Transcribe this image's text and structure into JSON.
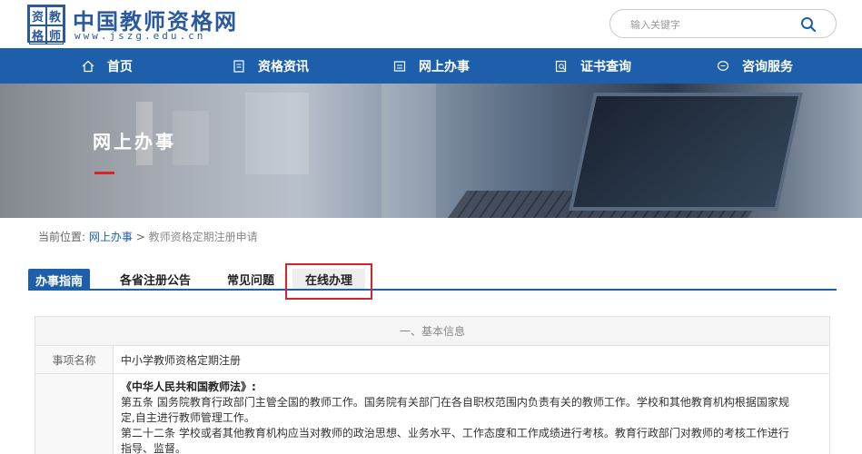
{
  "header": {
    "logo_chars": [
      "资",
      "教",
      "格",
      "师"
    ],
    "site_title": "中国教师资格网",
    "site_url": "www.jszg.edu.cn",
    "search_placeholder": "输入关键字"
  },
  "nav": {
    "items": [
      {
        "label": "首页",
        "icon": "home-icon"
      },
      {
        "label": "资格资讯",
        "icon": "document-icon"
      },
      {
        "label": "网上办事",
        "icon": "window-icon"
      },
      {
        "label": "证书查询",
        "icon": "search-doc-icon"
      },
      {
        "label": "咨询服务",
        "icon": "chat-icon"
      }
    ]
  },
  "banner": {
    "title": "网上办事"
  },
  "breadcrumb": {
    "prefix": "当前位置:",
    "link": "网上办事",
    "separator": ">",
    "current": "教师资格定期注册申请"
  },
  "tabs": [
    {
      "label": "办事指南",
      "active": true
    },
    {
      "label": "各省注册公告",
      "active": false
    },
    {
      "label": "常见问题",
      "active": false
    },
    {
      "label": "在线办理",
      "active": false,
      "highlighted": true
    }
  ],
  "info": {
    "section_title": "一、基本信息",
    "item_name_label": "事项名称",
    "item_name_value": "中小学教师资格定期注册",
    "law_title": "《中华人民共和国教师法》:",
    "law_line_1": "第五条 国务院教育行政部门主管全国的教师工作。国务院有关部门在各自职权范围内负责有关的教师工作。学校和其他教育机构根据国家规",
    "law_line_2": "定,自主进行教师管理工作。",
    "law_line_3": "第二十二条 学校或者其他教育机构应当对教师的政治思想、业务水平、工作态度和工作成绩进行考核。教育行政部门对教师的考核工作进行",
    "law_line_4": "指导、监督。"
  },
  "colors": {
    "brand_blue": "#1d5faa",
    "highlight_red": "#d7242b"
  }
}
